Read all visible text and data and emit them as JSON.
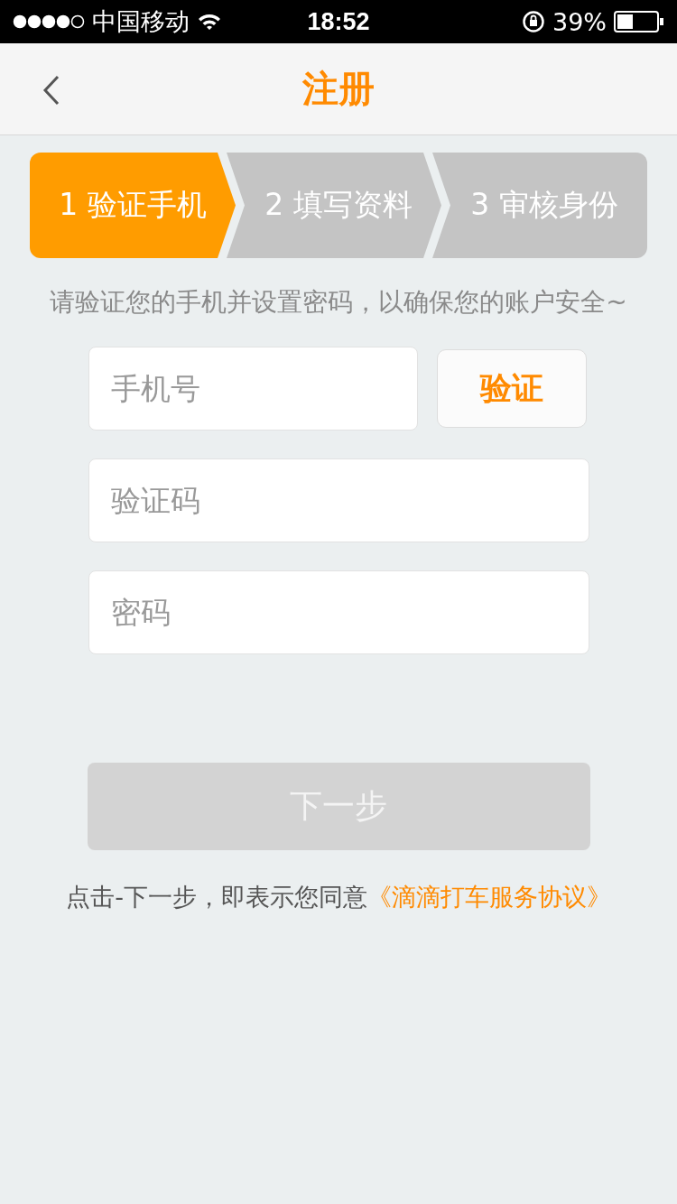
{
  "status_bar": {
    "carrier": "中国移动",
    "time": "18:52",
    "battery": "39%"
  },
  "nav": {
    "title": "注册"
  },
  "steps": [
    {
      "label": "1 验证手机",
      "selected": true
    },
    {
      "label": "2 填写资料",
      "selected": false
    },
    {
      "label": "3 审核身份",
      "selected": false
    }
  ],
  "hint": "请验证您的手机并设置密码，以确保您的账户安全~",
  "phone_field": {
    "placeholder": "手机号"
  },
  "verify_button": "验证",
  "code_field": {
    "placeholder": "验证码"
  },
  "password_field": {
    "placeholder": "密码"
  },
  "next_button": {
    "label": "下一步",
    "disabled": true
  },
  "agreement": {
    "text": "点击-下一步，即表示您同意",
    "link": "《滴滴打车服务协议》"
  }
}
